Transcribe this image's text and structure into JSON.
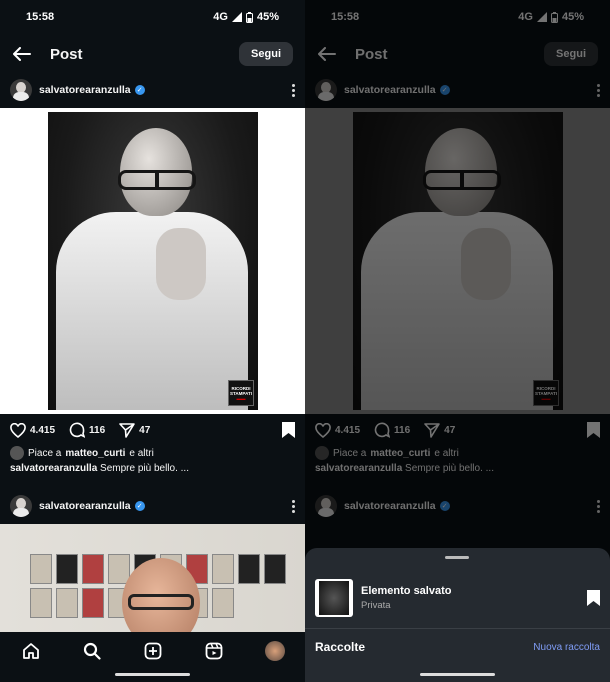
{
  "status": {
    "time": "15:58",
    "network": "4G",
    "battery": "45%"
  },
  "appbar": {
    "title": "Post",
    "follow_label": "Segui"
  },
  "post": {
    "username": "salvatorearanzulla",
    "likes_count": "4.415",
    "comments_count": "116",
    "shares_count": "47",
    "liked_by_prefix": "Piace a",
    "liked_by_user": "matteo_curti",
    "liked_by_suffix": "e altri",
    "caption_user": "salvatorearanzulla",
    "caption_text": "Sempre più bello. ...",
    "photo_logo_line1": "RICORDI",
    "photo_logo_line2": "STAMPATI"
  },
  "next_post": {
    "username": "salvatorearanzulla"
  },
  "sheet": {
    "saved_title": "Elemento salvato",
    "saved_subtitle": "Privata",
    "collections_label": "Raccolte",
    "new_collection_label": "Nuova raccolta"
  },
  "icons": [
    "back-arrow-icon",
    "verified-icon",
    "more-icon",
    "heart-icon",
    "comment-icon",
    "share-icon",
    "bookmark-icon",
    "home-icon",
    "search-icon",
    "create-icon",
    "reels-icon",
    "profile-icon"
  ],
  "colors": {
    "background": "#0b1014",
    "verified": "#3897f0",
    "link": "#7f9cf5",
    "sheet": "#252a30"
  }
}
